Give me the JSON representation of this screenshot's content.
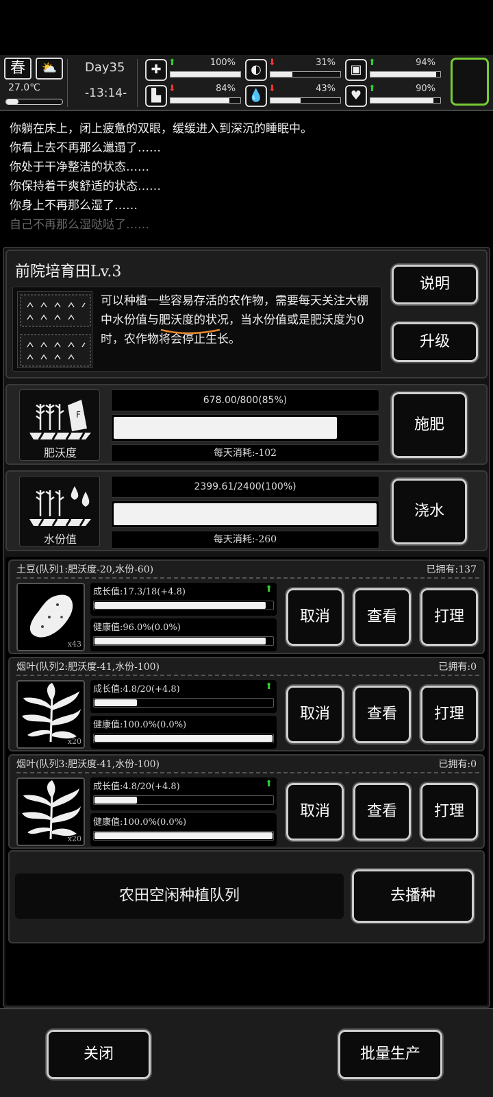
{
  "status": {
    "season": "春",
    "weather_icon": "partly-cloudy-icon",
    "temperature": "27.0℃",
    "day": "Day35",
    "time": "-13:14-",
    "stats": [
      {
        "icon": "medkit-icon",
        "glyph": "✚",
        "trend": "up",
        "value": "100%",
        "level": 1.0
      },
      {
        "icon": "stomach-icon",
        "glyph": "◐",
        "trend": "down",
        "value": "31%",
        "level": 0.31
      },
      {
        "icon": "bag-icon",
        "glyph": "▣",
        "trend": "up",
        "value": "94%",
        "level": 0.94
      },
      {
        "icon": "boot-icon",
        "glyph": "▙",
        "trend": "down",
        "value": "84%",
        "level": 0.84
      },
      {
        "icon": "water-drop-icon",
        "glyph": "💧",
        "trend": "down",
        "value": "43%",
        "level": 0.43
      },
      {
        "icon": "heart-icon",
        "glyph": "♥",
        "trend": "up",
        "value": "90%",
        "level": 0.9
      }
    ]
  },
  "log": [
    "你躺在床上，闭上疲惫的双眼，缓缓进入到深沉的睡眠中。",
    "你看上去不再那么邋遢了……",
    "你处于干净整洁的状态……",
    "你保持着干爽舒适的状态……",
    "你身上不再那么湿了……",
    "自己不再那么湿哒哒了……"
  ],
  "field": {
    "title": "前院培育田Lv.3",
    "description": "可以种植一些容易存活的农作物，需要每天关注大棚中水份值与肥沃度的状况，当水份值或是肥沃度为0时，农作物将会停止生长。",
    "explain_label": "说明",
    "upgrade_label": "升级"
  },
  "fertility": {
    "icon_label": "肥沃度",
    "value_text": "678.00/800(85%)",
    "level": 0.85,
    "daily": "每天消耗:-102",
    "action_label": "施肥"
  },
  "moisture": {
    "icon_label": "水份值",
    "value_text": "2399.61/2400(100%)",
    "level": 1.0,
    "daily": "每天消耗:-260",
    "action_label": "浇水"
  },
  "crops": [
    {
      "header": "土豆(队列1:肥沃度-20,水份-60)",
      "owned": "已拥有:137",
      "count": "x43",
      "icon": "potato-icon",
      "growth": "成长值:17.3/18(+4.8)",
      "growth_level": 0.96,
      "health": "健康值:96.0%(0.0%)",
      "health_level": 0.96,
      "cancel": "取消",
      "view": "查看",
      "tend": "打理"
    },
    {
      "header": "烟叶(队列2:肥沃度-41,水份-100)",
      "owned": "已拥有:0",
      "count": "x20",
      "icon": "tobacco-leaf-icon",
      "growth": "成长值:4.8/20(+4.8)",
      "growth_level": 0.24,
      "health": "健康值:100.0%(0.0%)",
      "health_level": 1.0,
      "cancel": "取消",
      "view": "查看",
      "tend": "打理"
    },
    {
      "header": "烟叶(队列3:肥沃度-41,水份-100)",
      "owned": "已拥有:0",
      "count": "x20",
      "icon": "tobacco-leaf-icon",
      "growth": "成长值:4.8/20(+4.8)",
      "growth_level": 0.24,
      "health": "健康值:100.0%(0.0%)",
      "health_level": 1.0,
      "cancel": "取消",
      "view": "查看",
      "tend": "打理"
    }
  ],
  "idle": {
    "text": "农田空闲种植队列",
    "action": "去播种"
  },
  "bottom": {
    "close": "关闭",
    "batch": "批量生产"
  },
  "colors": {
    "accent_green": "#7c3",
    "up": "#33cc33",
    "down": "#ee3333"
  }
}
